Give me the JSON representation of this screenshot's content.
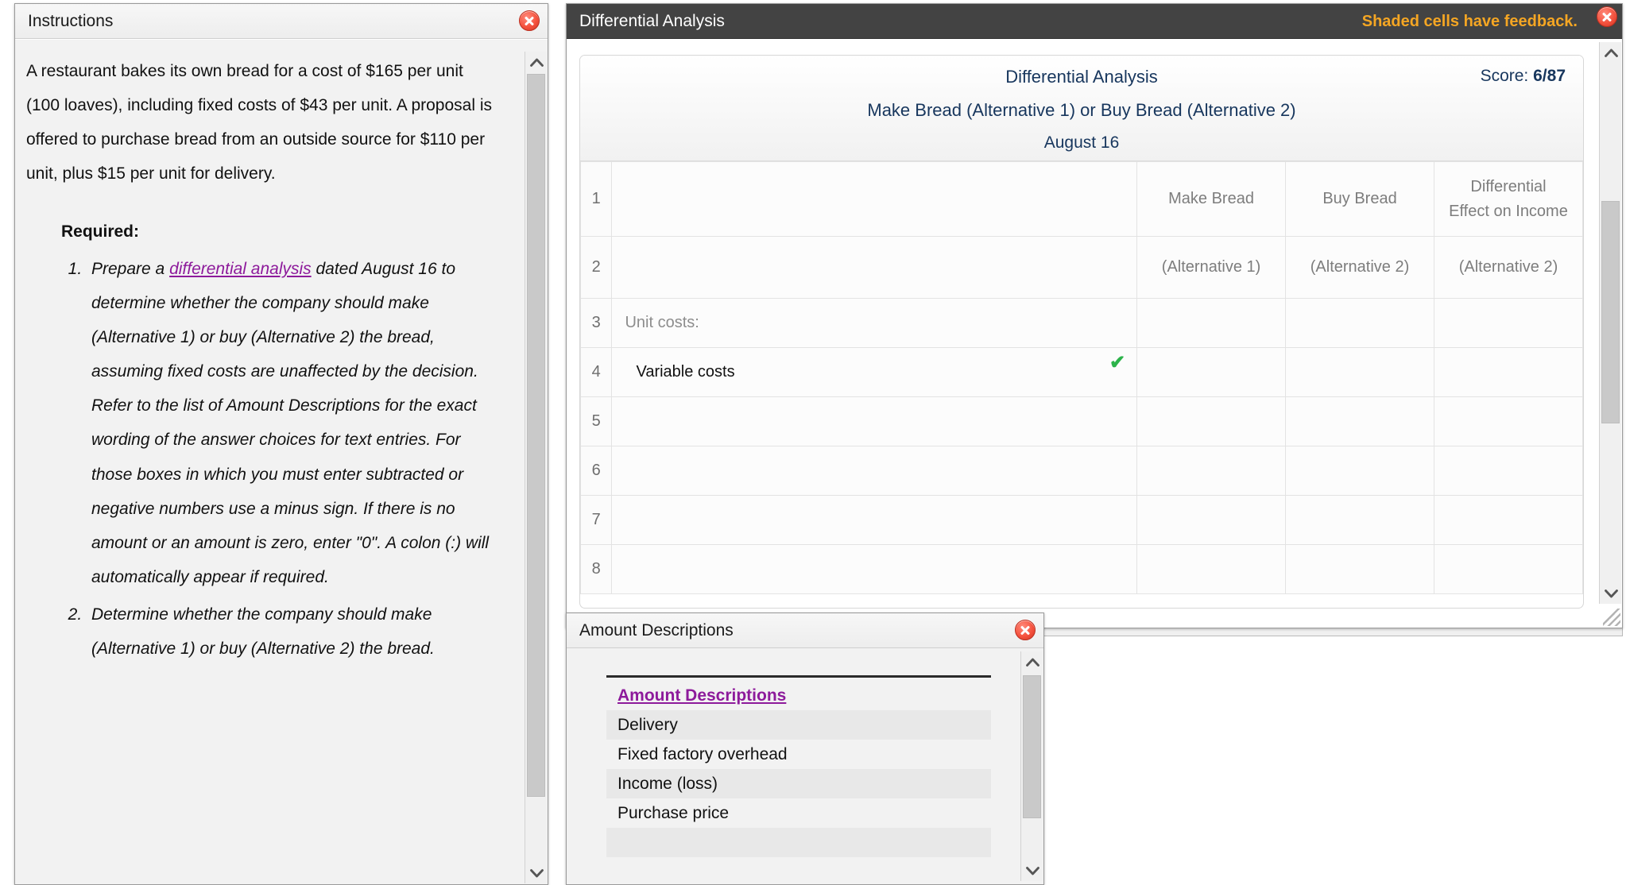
{
  "instructions": {
    "window_title": "Instructions",
    "close_label": "X",
    "lead": "A restaurant bakes its own bread for a cost of $165 per unit (100 loaves), including fixed costs of $43 per unit. A proposal is offered to purchase bread from an outside source for $110 per unit, plus $15 per unit for delivery.",
    "required_heading": "Required:",
    "items": [
      {
        "before_link": "Prepare a ",
        "link": "differential analysis",
        "after_link": " dated August 16 to determine whether the company should make (Alternative 1) or buy (Alternative 2) the bread, assuming fixed costs are unaffected by the decision. Refer to the list of Amount Descriptions for the exact wording of the answer choices for text entries. For those boxes in which you must enter subtracted or negative numbers use a minus sign. If there is no amount or an amount is zero, enter \"0\". A colon (:) will automatically appear if required."
      },
      {
        "before_link": "Determine whether the company should make (Alternative 1) or buy (Alternative 2) the bread.",
        "link": "",
        "after_link": ""
      }
    ]
  },
  "differential": {
    "window_title": "Differential Analysis",
    "feedback_note": "Shaded cells have feedback.",
    "close_label": "X",
    "sheet_title": "Differential Analysis",
    "sheet_subtitle": "Make Bread (Alternative 1) or Buy Bread (Alternative 2)",
    "sheet_date": "August 16",
    "score_label": "Score:",
    "score_value": "6/87",
    "columns": {
      "make": "Make Bread",
      "buy": "Buy Bread",
      "differential_line1": "Differential",
      "differential_line2": "Effect on Income",
      "make_alt": "(Alternative 1)",
      "buy_alt": "(Alternative 2)",
      "diff_alt": "(Alternative 2)"
    },
    "rows": [
      {
        "num": "1",
        "label": "",
        "make": "",
        "buy": "",
        "diff": ""
      },
      {
        "num": "2",
        "label": "",
        "make": "",
        "buy": "",
        "diff": ""
      },
      {
        "num": "3",
        "label": "Unit costs:",
        "make": "",
        "buy": "",
        "diff": ""
      },
      {
        "num": "4",
        "label": "Variable costs",
        "make": "",
        "buy": "",
        "diff": ""
      },
      {
        "num": "5",
        "label": "",
        "make": "",
        "buy": "",
        "diff": ""
      },
      {
        "num": "6",
        "label": "",
        "make": "",
        "buy": "",
        "diff": ""
      },
      {
        "num": "7",
        "label": "",
        "make": "",
        "buy": "",
        "diff": ""
      },
      {
        "num": "8",
        "label": "",
        "make": "",
        "buy": "",
        "diff": ""
      }
    ]
  },
  "amounts": {
    "window_title": "Amount Descriptions",
    "close_label": "X",
    "list_header": "Amount Descriptions",
    "items": [
      "Delivery",
      "Fixed factory overhead",
      "Income (loss)",
      "Purchase price"
    ]
  },
  "colors": {
    "accent_link": "#8d1a9b",
    "feedback_orange": "#f5a623",
    "header_dark": "#434343",
    "sheet_text": "#17365d",
    "check_green": "#2cb34a",
    "close_red": "#f4503c"
  }
}
